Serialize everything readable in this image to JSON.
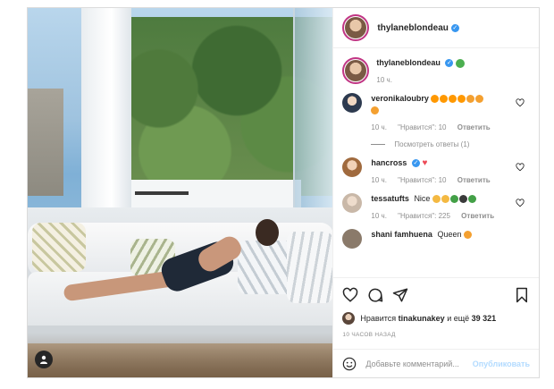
{
  "header": {
    "username": "thylaneblondeau"
  },
  "caption": {
    "username": "thylaneblondeau",
    "time": "10 ч."
  },
  "comments": [
    {
      "username": "veronikaloubry",
      "text": "",
      "time": "10 ч.",
      "likes": "",
      "reply": "",
      "view_replies": ""
    },
    {
      "username": "",
      "text": "",
      "time": "10 ч.",
      "likes": "\"Нравится\": 10",
      "reply": "Ответить",
      "view_replies": "Посмотреть ответы (1)"
    },
    {
      "username": "hancross",
      "text": "",
      "time": "10 ч.",
      "likes": "\"Нравится\": 10",
      "reply": "Ответить"
    },
    {
      "username": "tessatufts",
      "text": "Nice",
      "time": "10 ч.",
      "likes": "\"Нравится\": 225",
      "reply": "Ответить"
    },
    {
      "username": "shani famhuena",
      "text": "Queen"
    }
  ],
  "likes": {
    "prefix": "Нравится",
    "user": "tinakunakey",
    "middle": "и ещё",
    "count": "39 321"
  },
  "time_ago": "10 ЧАСОВ НАЗАД",
  "add_comment": {
    "placeholder": "Добавьте комментарий...",
    "post_label": "Опубликовать"
  },
  "colors": {
    "accent": "#3897f0",
    "post_disabled": "#b3dbff",
    "heart": "#ed4956",
    "ring": "#c13584"
  },
  "icons": [
    "verified-icon",
    "heart-icon",
    "comment-icon",
    "share-icon",
    "bookmark-icon",
    "smiley-icon",
    "user-tag-icon"
  ]
}
